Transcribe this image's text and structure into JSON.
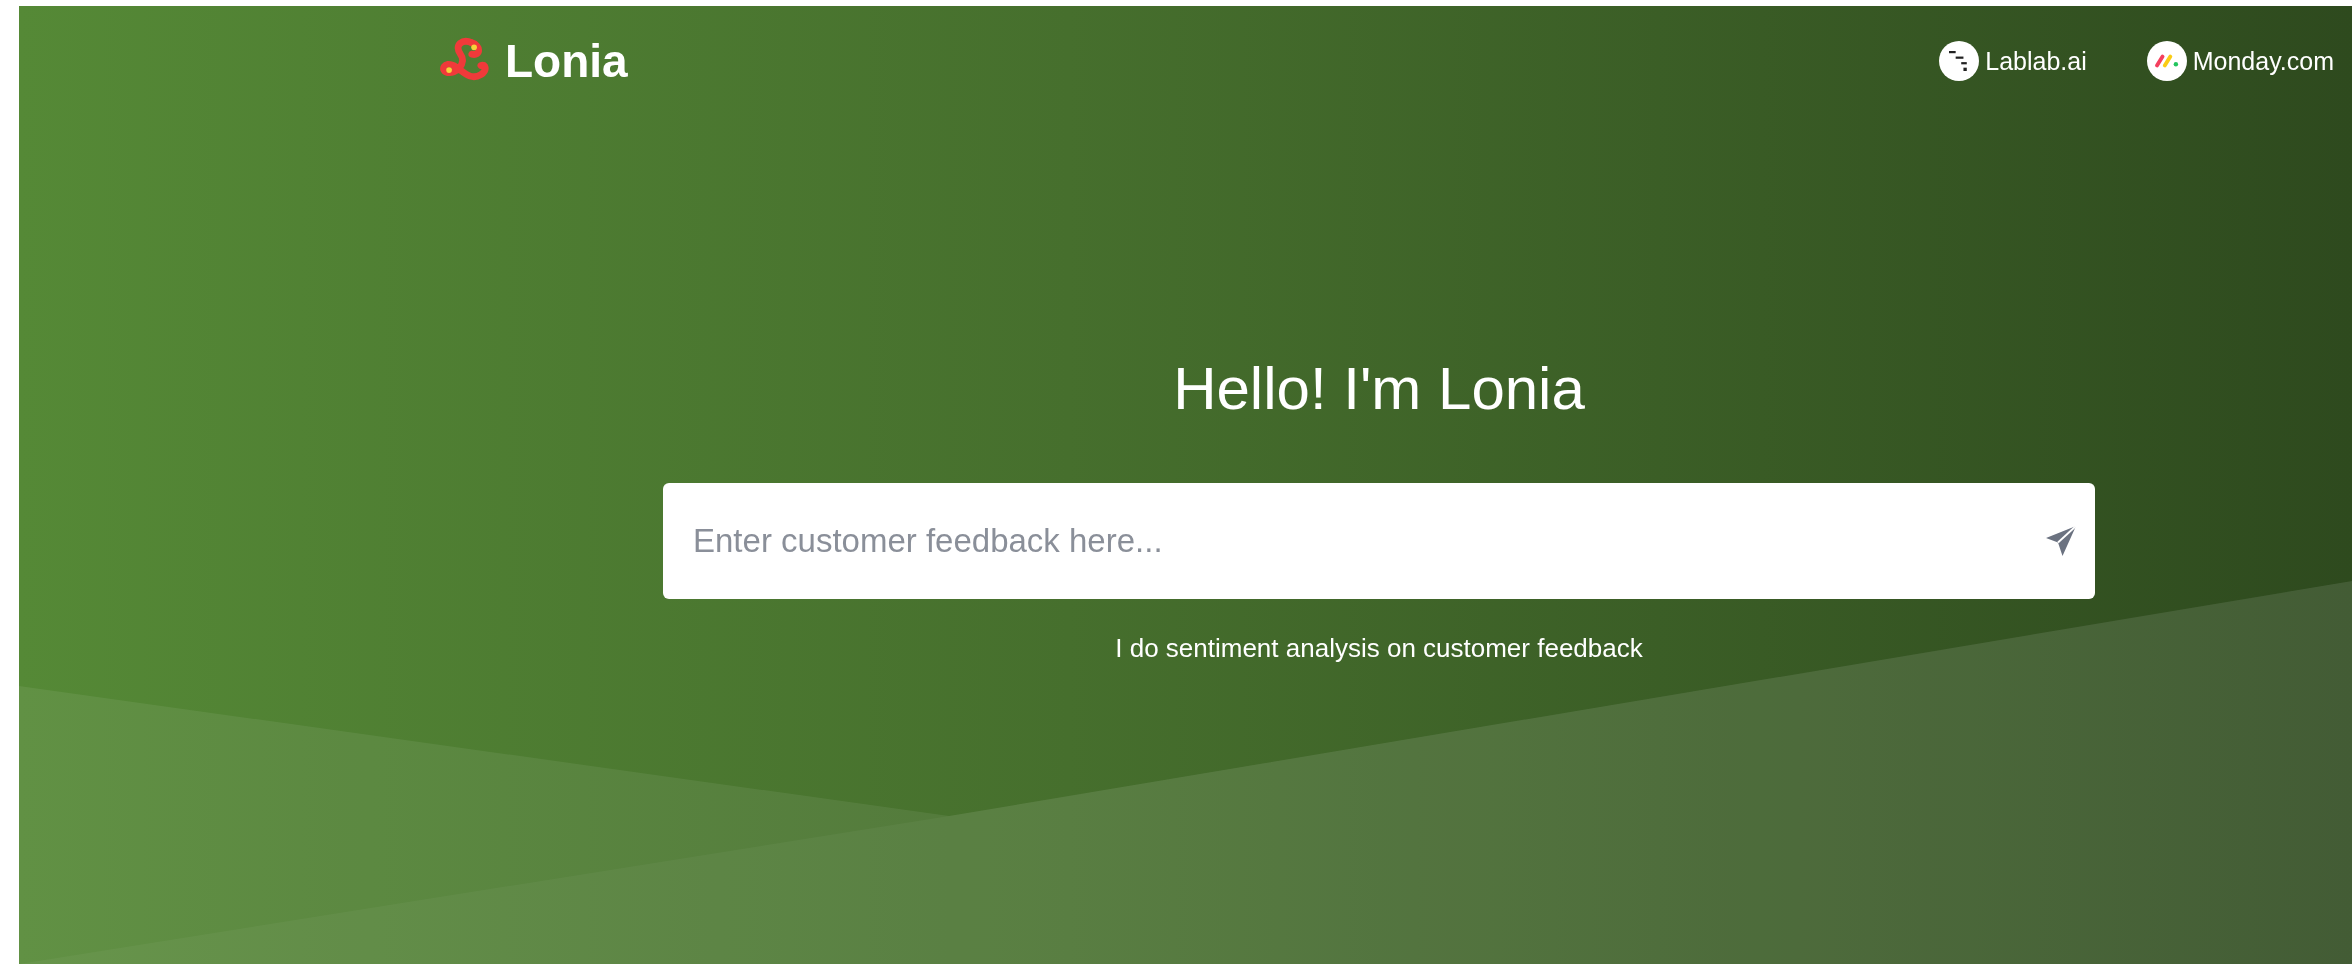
{
  "brand": {
    "name": "Lonia"
  },
  "nav_links": [
    {
      "label": "Lablab.ai",
      "kind": "lablab"
    },
    {
      "label": "Monday.com",
      "kind": "monday"
    }
  ],
  "hero": {
    "title": "Hello! I'm Lonia",
    "search": {
      "placeholder": "Enter customer feedback here..."
    },
    "caption": "I do sentiment analysis on customer feedback"
  }
}
